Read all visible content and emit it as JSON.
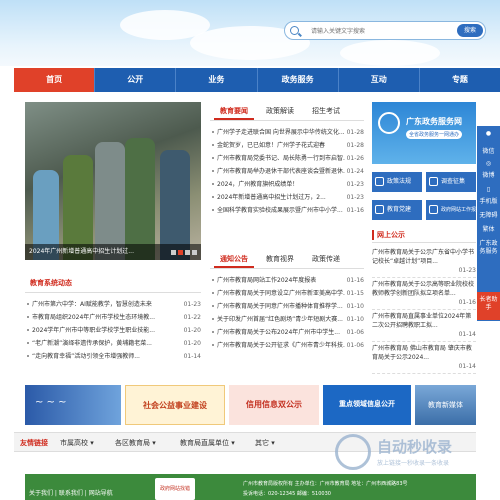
{
  "search": {
    "placeholder": "请输入关键文字搜索",
    "button": "搜索"
  },
  "nav": [
    "首页",
    "公开",
    "业务",
    "政务服务",
    "互动",
    "专题"
  ],
  "slider": {
    "caption": "2024年广州新增普通高中招生计划过..."
  },
  "news": {
    "tabs": [
      "教育要闻",
      "政策解读",
      "招生考试"
    ],
    "items": [
      {
        "t": "广州学子走进联合国 向世界展示中华传统文化...",
        "d": "01-28"
      },
      {
        "t": "金蛇贺岁，已已如意！广州学子花式迎春",
        "d": "01-28"
      },
      {
        "t": "广州市教育局党委书记、局长陈勇一行到市启智...",
        "d": "01-26"
      },
      {
        "t": "广州市教育局举办退休干部代表座谈会暨新退休...",
        "d": "01-24"
      },
      {
        "t": "2024，广州教育旗帜成绩单！",
        "d": "01-23"
      },
      {
        "t": "2024年新增普通高中招生计划过万，2...",
        "d": "01-23"
      },
      {
        "t": "全国科学教育实验校成果展示暨广州市中小学...",
        "d": "01-16"
      }
    ]
  },
  "gov": {
    "title": "广东政务服务网",
    "subtitle": "全省政务服务一网通办"
  },
  "govButtons": [
    "政策法规",
    "调查征集",
    "教育党建",
    "政府网站工作报表"
  ],
  "notice": {
    "tabs": [
      "通知公告",
      "教育视界",
      "政策传递"
    ],
    "items": [
      {
        "t": "广州市教育局网站工作2024年度报表",
        "d": "01-16"
      },
      {
        "t": "广州市教育局关于同意设立广州市新亚美高中学...",
        "d": "01-15"
      },
      {
        "t": "广州市教育局关于同意广州市播种体育推荐学...",
        "d": "01-10"
      },
      {
        "t": "关于印发广州首届“红色剧场”青少年短剧大赛...",
        "d": "01-10"
      },
      {
        "t": "广州市教育局关于公布2024年广州市中学生...",
        "d": "01-06"
      },
      {
        "t": "广州市教育局关于公开征求《广州市青少年科技...",
        "d": "01-06"
      }
    ]
  },
  "publicNotice": {
    "title": "网上公示",
    "items": [
      {
        "t": "广州市教育局关于公示广东省中小学书记校长“卓越计划”项目...",
        "d": "01-23"
      },
      {
        "t": "广州市教育局关于公示高等职业院校校教师教学创新团队拟立项名单...",
        "d": "01-16"
      },
      {
        "t": "广州市教育局直属事业单位2024年第二次公开招聘教职工拟...",
        "d": "01-14"
      },
      {
        "t": "广州市教育局 佛山市教育局 肇庆市教育局关于公示2024...",
        "d": "01-14"
      }
    ]
  },
  "system": {
    "title": "教育系统动态",
    "items": [
      {
        "t": "广州市第六中学：AI赋能教学，智慧创造未来",
        "d": "01-23"
      },
      {
        "t": "市教育局组织2024年广州市学校生态环境教...",
        "d": "01-22"
      },
      {
        "t": "2024学年广州市中等职业学校学生职业技能...",
        "d": "01-20"
      },
      {
        "t": "“老广新潮”演绎非遗传承保护，黄埔籍老菜...",
        "d": "01-20"
      },
      {
        "t": "“走向教育幸福”活动引领全市增强教师...",
        "d": "01-14"
      }
    ]
  },
  "banners": [
    "社会公益事业建设",
    "信用信息双公示",
    "重点领域信息公开",
    "教育新媒体"
  ],
  "links": {
    "title": "友情链接",
    "items": [
      "市属高校",
      "各区教育局",
      "教育局直属单位",
      "其它"
    ]
  },
  "footer": {
    "links": [
      "关于我们",
      "联系我们",
      "网站导航"
    ],
    "line1": "广州市教育局版权所有 主办单位：广州市教育局 地址：广州市西城路83号",
    "line2": "投诉电话：020-12345 邮编：510030",
    "badge": "政府网站找错"
  },
  "float": [
    "微信",
    "微博",
    "手机版",
    "无障碍",
    "繁体",
    "广东政务服务",
    "长者助手"
  ],
  "watermark": {
    "title": "自动秒收录",
    "sub": "放上链接一秒收录一条收录"
  }
}
